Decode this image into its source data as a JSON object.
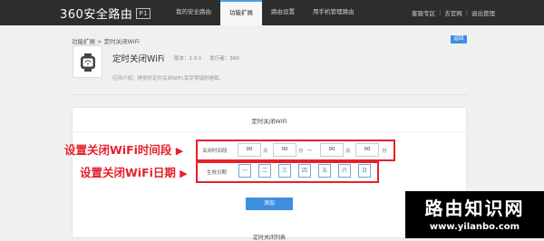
{
  "header": {
    "logo_text": "360安全路由",
    "logo_badge": "P1",
    "nav": [
      "我的安全路由",
      "功能扩展",
      "路由设置",
      "用手机管理路由"
    ],
    "active_nav_index": 1,
    "right_links": [
      "客服专区",
      "去官网",
      "退出管理"
    ]
  },
  "breadcrumb": {
    "parent": "功能扩展",
    "separator": ">",
    "current": "定时关闭WiFi"
  },
  "back_button": "返回",
  "app": {
    "icon": "watch-icon",
    "name": "定时关闭WiFi",
    "version_label": "版本：1.0.1",
    "publisher_label": "发行者：360",
    "description": "应用介绍：睡觉时定时关闭WiFi,享受零辐射睡眠。"
  },
  "panel": {
    "title": "定时关闭WiFi",
    "period": {
      "label": "关闭时间段",
      "start_hour": "00",
      "hour_unit": "点",
      "start_minute": "00",
      "minute_unit": "分",
      "range_sep": "～",
      "end_hour": "00",
      "end_minute": "00"
    },
    "days": {
      "label": "生效日期",
      "items": [
        "一",
        "二",
        "三",
        "四",
        "五",
        "六",
        "日"
      ]
    },
    "add_button": "添加",
    "list_title": "定时关闭列表"
  },
  "annotations": {
    "period": "设置关闭WiFi时间段",
    "days": "设置关闭WiFi日期",
    "color": "#e8202a"
  },
  "watermark": {
    "title": "路由知识网",
    "url": "www.yilanbo.com"
  },
  "colors": {
    "topbar": "#2d2d2d",
    "accent": "#3d8fe0",
    "annotation": "#e8202a"
  }
}
